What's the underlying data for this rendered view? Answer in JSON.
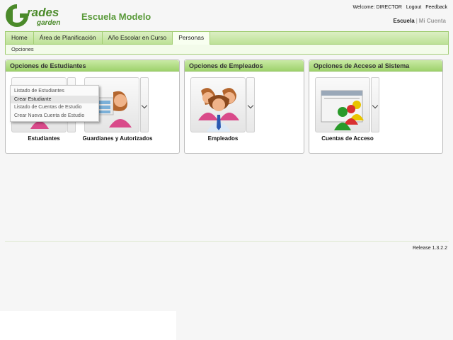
{
  "brand": {
    "logo_line1": "rades",
    "logo_line2": "garden",
    "logo_g": "G",
    "school": "Escuela Modelo"
  },
  "user_bar": {
    "welcome": "Welcome: DIRECTOR",
    "logout": "Logout",
    "feedback": "Feedback"
  },
  "context": {
    "active": "Escuela",
    "separator": "|",
    "other": "Mi Cuenta"
  },
  "nav": {
    "tabs": [
      "Home",
      "Área de Planificación",
      "Año Escolar en Curso",
      "Personas"
    ],
    "active_index": 3,
    "subtab": "Opciones"
  },
  "panels": {
    "students": {
      "title": "Opciones de Estudiantes",
      "tile1_label": "Estudiantes",
      "tile2_label": "Guardianes y Autorizados"
    },
    "employees": {
      "title": "Opciones de Empleados",
      "tile_label": "Empleados"
    },
    "access": {
      "title": "Opciones de Acceso al Sistema",
      "tile_label": "Cuentas de Acceso"
    }
  },
  "dropdown": {
    "items": [
      "Listado de Estudiantes",
      "Crear Estudiante",
      "Listado de Cuentas de Estudio",
      "Crear Nueva Cuenta de Estudio"
    ],
    "highlighted_index": 1
  },
  "footer": {
    "release": "Release 1.3.2.2"
  },
  "colors": {
    "accent_green": "#5a9a3a",
    "header_green": "#9fd26d",
    "person_pink": "#d94a8a",
    "person_blue": "#4a8fd9"
  }
}
